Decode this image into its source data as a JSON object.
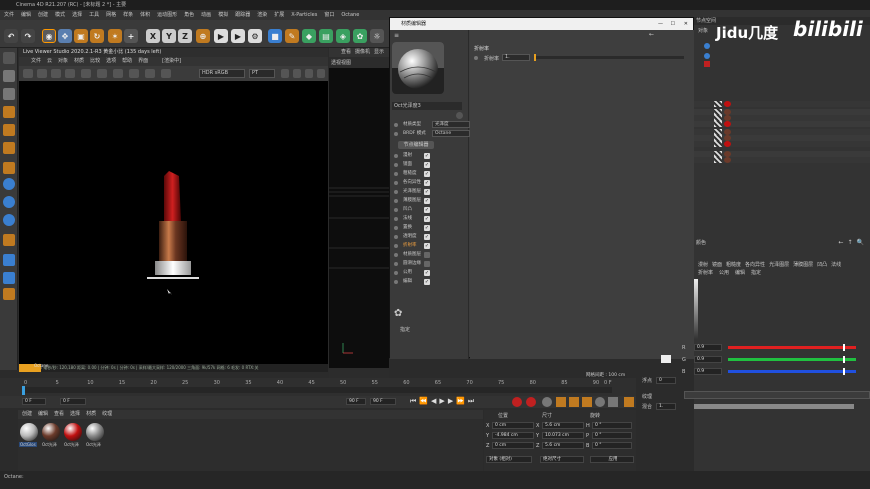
{
  "app": {
    "title": "Cinema 4D R21.207 (RC) - [未标题 2 *] - 主要",
    "menus": [
      "文件",
      "编辑",
      "创建",
      "模式",
      "选择",
      "工具",
      "网格",
      "样条",
      "体积",
      "运动图形",
      "角色",
      "动画",
      "模拟",
      "跟踪器",
      "渲染",
      "扩展",
      "X-Particles",
      "窗口",
      "Octane"
    ]
  },
  "toolbar": {
    "axis_x": "X",
    "axis_y": "Y",
    "axis_z": "Z"
  },
  "viewport": {
    "title": "Live Viewer Studio 2020.2.1-R3 黄金小比 (135 days left)",
    "menus": [
      "文件",
      "云",
      "对象",
      "材质",
      "比较",
      "选项",
      "帮助",
      "界面"
    ],
    "status_tag": "[渲染中]",
    "color_mode": "HDR sRGB",
    "pt_mode": "PT",
    "status_line": "已渲染: 0% 毫秒/秒: 120,180 距离: 0.00 | 分钟: 0s | 分钟: 0s | 采样/最大采样: 120/2000 三角面: 9k/57k 网格: 6 毛发: 0 RTX:关",
    "badge_name": "Octane",
    "progress": 0.07
  },
  "timeline": {
    "ticks": [
      "0",
      "5",
      "10",
      "15",
      "20",
      "25",
      "30",
      "35",
      "40",
      "45",
      "50",
      "55",
      "60",
      "65",
      "70",
      "75",
      "80",
      "85",
      "90"
    ],
    "end_label": "0 F",
    "current_frame": "0 F",
    "start_frame": "0 F",
    "end_frame": "90 F",
    "end_frame2": "90 F"
  },
  "material_manager": {
    "menus": [
      "创建",
      "编辑",
      "查看",
      "选择",
      "材质",
      "纹理"
    ],
    "materials": [
      {
        "label": "OctGlos",
        "color": "#b9b9b9"
      },
      {
        "label": "Oct光泽",
        "color": "#6b3a2a"
      },
      {
        "label": "Oct光泽",
        "color": "#c01010"
      },
      {
        "label": "Oct光泽",
        "color": "#8a8a8a"
      }
    ]
  },
  "coordinates": {
    "headers": [
      "位置",
      "尺寸",
      "旋转"
    ],
    "rows": [
      {
        "axis": "X",
        "pos": "0 cm",
        "size_axis": "X",
        "size": "5.6 cm",
        "rot_axis": "H",
        "rot": "0 °"
      },
      {
        "axis": "Y",
        "pos": "-4.984 cm",
        "size_axis": "Y",
        "size": "10.073 cm",
        "rot_axis": "P",
        "rot": "0 °"
      },
      {
        "axis": "Z",
        "pos": "0 cm",
        "size_axis": "Z",
        "size": "5.6 cm",
        "rot_axis": "B",
        "rot": "0 °"
      }
    ],
    "mode": "对象 (相对)",
    "size_mode": "绝对尺寸",
    "apply": "应用"
  },
  "material_editor": {
    "title": "材质编辑器",
    "material_name": "Oct光泽度3",
    "material_type_label": "材质类型",
    "material_type_value": "光泽度",
    "brdf_label": "BRDF 模式",
    "brdf_value": "Octane",
    "node_editor_btn": "节点编辑器",
    "channels": [
      {
        "name": "漫射",
        "checked": true
      },
      {
        "name": "镜面",
        "checked": true
      },
      {
        "name": "粗糙度",
        "checked": true
      },
      {
        "name": "各向异性",
        "checked": true
      },
      {
        "name": "光泽图层",
        "checked": true
      },
      {
        "name": "薄膜图层",
        "checked": true
      },
      {
        "name": "凹凸",
        "checked": true
      },
      {
        "name": "法线",
        "checked": true
      },
      {
        "name": "置换",
        "checked": true
      },
      {
        "name": "透明度",
        "checked": true
      },
      {
        "name": "折射率",
        "checked": true,
        "active": true
      },
      {
        "name": "材质图层",
        "checked": false
      },
      {
        "name": "圆滑边缘",
        "checked": false
      },
      {
        "name": "公用",
        "checked": true
      },
      {
        "name": "编辑",
        "checked": true
      }
    ],
    "assign_label": "指定",
    "section_title": "折射率",
    "ior_label": "折射率",
    "ior_value": "1."
  },
  "viewer_side": {
    "tab1": "查看",
    "tab2": "摄像机",
    "tab3": "显示",
    "panel_label": "透视视图",
    "grid_label": "网格间距 : 100 cm"
  },
  "object_panel": {
    "title": "节点空间",
    "object_tab": "对象"
  },
  "attr_panel": {
    "title": "颜色",
    "tabs": [
      "漫射",
      "镜面",
      "粗糙度",
      "各向异性",
      "光泽图层",
      "薄膜图层",
      "凹凸",
      "法线"
    ],
    "tabs2": [
      "折射率",
      "公用",
      "编辑",
      "指定"
    ],
    "rgb": [
      {
        "label": "R",
        "value": "0.9",
        "color": "#e02020",
        "level": 0.9
      },
      {
        "label": "G",
        "value": "0.9",
        "color": "#20c040",
        "level": 0.9
      },
      {
        "label": "B",
        "value": "0.9",
        "color": "#2050e0",
        "level": 0.9
      }
    ],
    "float_label": "浮点",
    "float_value": "0",
    "texture_label": "纹理",
    "mix_label": "混合",
    "mix_value": "1."
  },
  "watermarks": {
    "jidu": "Jidu几度",
    "bilibili": "bilibili"
  },
  "bottom": {
    "status": "Octane:"
  }
}
